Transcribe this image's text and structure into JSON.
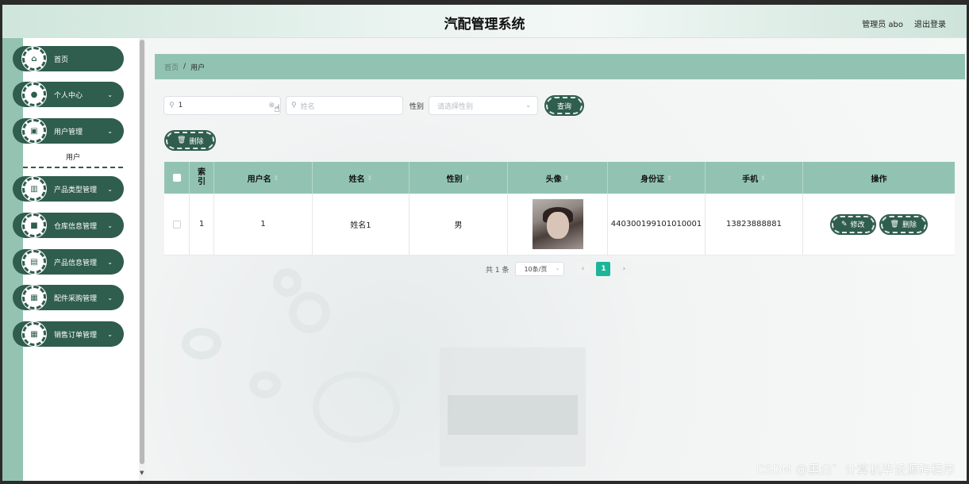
{
  "header": {
    "title": "汽配管理系统",
    "user": "管理员 abo",
    "logout": "退出登录"
  },
  "sidebar": {
    "items": [
      {
        "label": "首页",
        "icon": "⌂",
        "chevron": ""
      },
      {
        "label": "个人中心",
        "icon": "●",
        "chevron": "⌄"
      },
      {
        "label": "用户管理",
        "icon": "▣",
        "chevron": "⌄"
      },
      {
        "label": "产品类型管理",
        "icon": "▥",
        "chevron": "⌄"
      },
      {
        "label": "仓库信息管理",
        "icon": "■",
        "chevron": "⌄"
      },
      {
        "label": "产品信息管理",
        "icon": "▤",
        "chevron": "⌄"
      },
      {
        "label": "配件采购管理",
        "icon": "▦",
        "chevron": "⌄"
      },
      {
        "label": "销售订单管理",
        "icon": "▦",
        "chevron": "⌄"
      }
    ],
    "submenu": {
      "label": "用户"
    }
  },
  "breadcrumb": {
    "home": "首页",
    "separator": "/",
    "current": "用户"
  },
  "search": {
    "username_value": "1",
    "name_placeholder": "姓名",
    "gender_label": "性别",
    "gender_placeholder": "请选择性别",
    "query_label": "查询"
  },
  "toolbar": {
    "delete_label": "删除"
  },
  "table": {
    "headers": {
      "index": "索\n引",
      "username": "用户名",
      "name": "姓名",
      "gender": "性别",
      "avatar": "头像",
      "id_card": "身份证",
      "phone": "手机",
      "actions": "操作"
    },
    "rows": [
      {
        "index": "1",
        "username": "1",
        "name": "姓名1",
        "gender": "男",
        "id_card": "440300199101010001",
        "phone": "13823888881",
        "edit_label": "修改",
        "delete_label": "删除"
      }
    ]
  },
  "pagination": {
    "total": "共 1 条",
    "page_size": "10条/页",
    "current_page": "1",
    "prev": "‹",
    "next": "›"
  },
  "watermark": "CSDN @黑白゛计算机毕设源码程序",
  "colors": {
    "primary": "#2f5d4e",
    "accent": "#92c3b2",
    "active": "#1cb59a"
  }
}
